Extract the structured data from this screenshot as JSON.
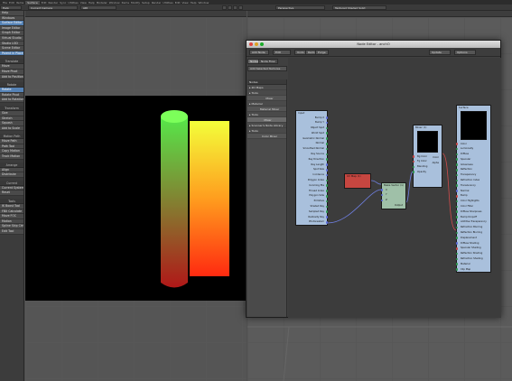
{
  "menubar": {
    "items": [
      "File",
      "Edit",
      "Items",
      "Surface",
      "Edit",
      "Render",
      "Sync",
      "Utilities",
      "View",
      "Help",
      "Modeler",
      "Window",
      "Items",
      "Modify",
      "Setup",
      "Render",
      "Utilities",
      "Edit",
      "View",
      "Help",
      "Window"
    ],
    "active_index": 3
  },
  "toolbar": {
    "left_select": "Help",
    "camera": "Current Camera",
    "view_mode": "Perspective",
    "shading": "Textured Shaded Solid",
    "zoom": "100",
    "offset": "ADI"
  },
  "sidebar": {
    "top_items": [
      "Help",
      "Windows",
      "Surface Editor",
      "Image Editor",
      "Graph Editor",
      "Virtual Studio",
      "Studio LOD",
      "Scene Editor"
    ],
    "top_highlight": [
      2
    ],
    "group_items": [
      "Parent in Place"
    ],
    "sections": [
      {
        "title": "Translate",
        "items": [
          "Move",
          "Move Pivot",
          "Add to Position"
        ]
      },
      {
        "title": "Rotate",
        "items": [
          "Rotate",
          "Rotate Pivot",
          "Add to Rotation"
        ],
        "highlight": 0
      },
      {
        "title": "Transform",
        "items": [
          "Size",
          "Stretch",
          "Squash",
          "Add to Scale"
        ]
      },
      {
        "title": "Motion Path",
        "items": [
          "Move Path",
          "Path Tool",
          "Copy Motion",
          "Track Motion"
        ]
      },
      {
        "title": "Arrange",
        "items": [
          "Align",
          "Distribute"
        ]
      },
      {
        "title": "Current",
        "items": [
          "Current System",
          "Reset"
        ]
      },
      {
        "title": "Tools",
        "items": [
          "IK Boost Tool",
          "FBX Calculate",
          "Move FOC",
          "Motion",
          "Spline Skip Ctrl",
          "Edit Tool"
        ]
      }
    ]
  },
  "node_editor": {
    "title": "Node Editor - anchO",
    "menus": [
      "Add Node",
      "Edit",
      "Undo",
      "Redo",
      "Purge"
    ],
    "right_buttons": [
      "Update",
      "Options"
    ],
    "tabs": [
      "Nodes",
      "Node Flow"
    ],
    "filter_placeholder": "Add Selected Textures",
    "tree_header": "Nodes",
    "tree": [
      {
        "label": "2D Maps",
        "kind": "cat"
      },
      {
        "label": "Tools",
        "kind": "cat"
      },
      {
        "label": "Mixer",
        "kind": "sub"
      },
      {
        "label": "Material",
        "kind": "cat"
      },
      {
        "label": "Material Mixer",
        "kind": "sub"
      },
      {
        "label": "Tools",
        "kind": "cat"
      },
      {
        "label": "Mixer",
        "kind": "sel"
      },
      {
        "label": "Scanner's Node Library",
        "kind": "cat"
      },
      {
        "label": "Tools",
        "kind": "cat"
      },
      {
        "label": "Color Mixer",
        "kind": "sub"
      }
    ],
    "nodes": {
      "input": {
        "title": "Input",
        "rows": [
          "Bump X",
          "Bump Y",
          "Object Spot",
          "World Spot",
          "Geometric Normal",
          "Normal",
          "Smoothed Normal",
          "Ray Source",
          "Ray Direction",
          "Ray Length",
          "Spot Size",
          "Incidence",
          "Polygon Index",
          "Incoming Eta",
          "Thread Index",
          "Polygon Side",
          "Primitive",
          "Shaded Ray",
          "Sampled Ray",
          "Radiosity Ray",
          "Photorealism"
        ]
      },
      "uv_map": {
        "title": "UV Map (1)"
      },
      "make_vector": {
        "title": "Make Vector (1)",
        "rows": [
          "X",
          "Y",
          "Z"
        ],
        "out": "Output"
      },
      "mixer": {
        "title": "Mixer (1)",
        "rows": [
          "Bg Color",
          "Fg Color",
          "Blending",
          "Opacity"
        ],
        "outs": [
          "Color",
          "Alpha"
        ]
      },
      "surface": {
        "title": "Surface",
        "rows": [
          "Color",
          "Luminosity",
          "Diffuse",
          "Specular",
          "Glossiness",
          "Reflection",
          "Transparency",
          "Refraction Index",
          "Translucency",
          "Normal",
          "Bump",
          "Color Highlights",
          "Color Filter",
          "Diffuse Sharpness",
          "Bump Dropoff",
          "Additive Transparency",
          "Refraction Blurring",
          "Reflection Blurring",
          "Displacement",
          "Diffuse Shading",
          "Specular Shading",
          "Reflection Shading",
          "Refraction Shading",
          "Material",
          "Clip Map"
        ]
      }
    }
  },
  "colors": {
    "cylinder_top": "#56e84a",
    "cylinder_bottom": "#b01818",
    "box_top": "#f3ff3a",
    "box_bottom": "#ff2a10",
    "input_node": "#a9c0dc",
    "uv_node": "#c64640",
    "vector_node": "#9fc0a8",
    "mixer_node": "#a9c0dc",
    "surface_node": "#a9c0dc"
  }
}
